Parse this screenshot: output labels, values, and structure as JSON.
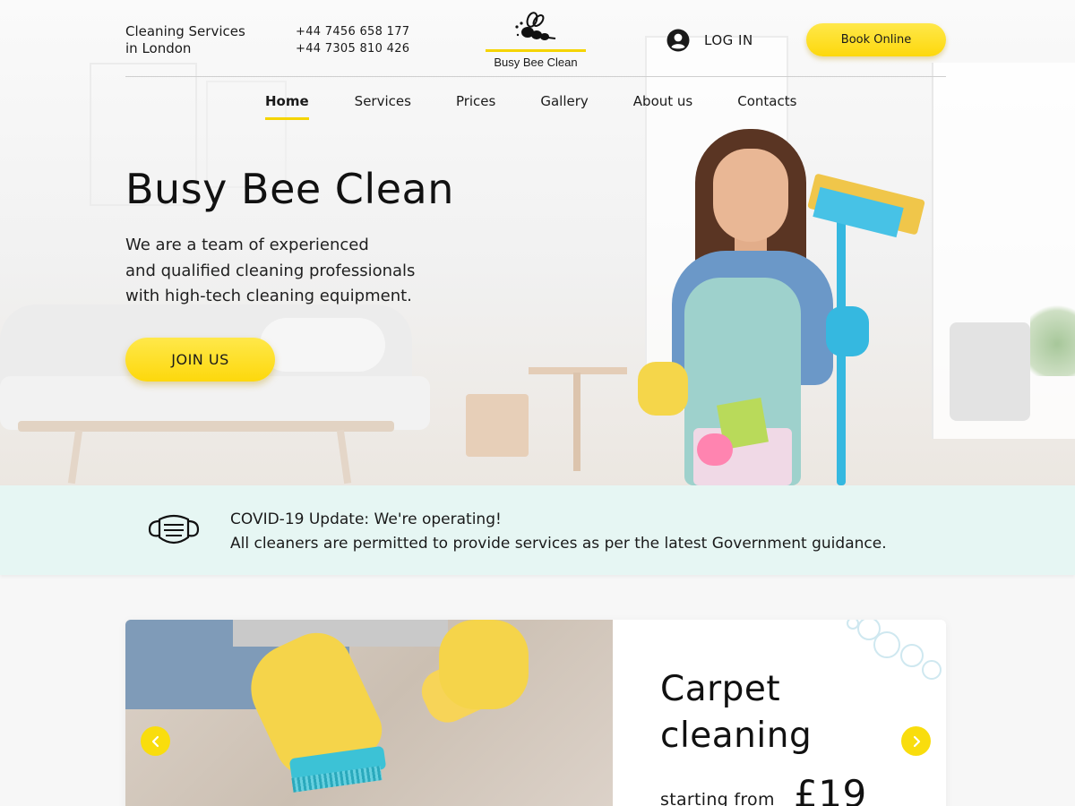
{
  "header": {
    "tagline_line1": "Cleaning Services",
    "tagline_line2": "in London",
    "phone1": "+44 7456 658 177",
    "phone2": "+44 7305 810 426",
    "brand_name": "Busy Bee Clean",
    "login_label": "LOG IN",
    "login_icon": "user-icon",
    "book_label": "Book Online"
  },
  "nav": {
    "items": [
      {
        "label": "Home",
        "active": true
      },
      {
        "label": "Services",
        "active": false
      },
      {
        "label": "Prices",
        "active": false
      },
      {
        "label": "Gallery",
        "active": false
      },
      {
        "label": "About us",
        "active": false
      },
      {
        "label": "Contacts",
        "active": false
      }
    ]
  },
  "hero": {
    "title": "Busy Bee Clean",
    "line1": "We are a team of experienced",
    "line2": "and qualified cleaning professionals",
    "line3": "with high-tech cleaning equipment.",
    "cta_label": "JOIN US"
  },
  "covid": {
    "icon": "face-mask-icon",
    "title": "COVID-19 Update: We're operating!",
    "text": "All cleaners are permitted to provide services as per the latest Government guidance."
  },
  "service_card": {
    "title_line1": "Carpet",
    "title_line2": "cleaning",
    "price_prefix": "starting from",
    "price": "£19",
    "prev_icon": "chevron-left-icon",
    "next_icon": "chevron-right-icon"
  },
  "colors": {
    "accent_yellow": "#f9dd0d",
    "covid_bg": "#e6f6f3",
    "text": "#1a1a1a"
  }
}
